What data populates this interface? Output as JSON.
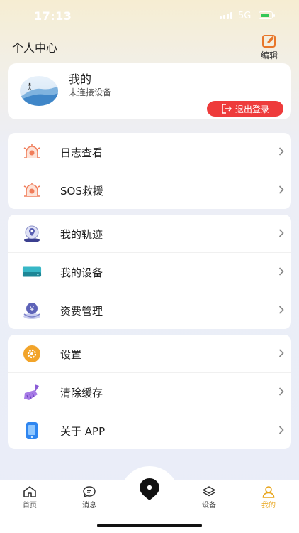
{
  "status_bar": {
    "time": "17:13",
    "network": "5G"
  },
  "header": {
    "title": "个人中心",
    "edit_label": "编辑"
  },
  "profile": {
    "name": "我的",
    "status": "未连接设备",
    "logout_label": "退出登录"
  },
  "menu_groups": [
    [
      {
        "label": "日志查看",
        "icon": "log-icon"
      },
      {
        "label": "SOS救援",
        "icon": "sos-icon"
      }
    ],
    [
      {
        "label": "我的轨迹",
        "icon": "track-icon"
      },
      {
        "label": "我的设备",
        "icon": "device-icon"
      },
      {
        "label": "资费管理",
        "icon": "billing-icon"
      }
    ],
    [
      {
        "label": "设置",
        "icon": "gear-icon"
      },
      {
        "label": "清除缓存",
        "icon": "broom-icon"
      },
      {
        "label": "关于 APP",
        "icon": "phone-icon"
      }
    ]
  ],
  "tabbar": {
    "items": [
      {
        "label": "首页",
        "icon": "home-icon"
      },
      {
        "label": "消息",
        "icon": "message-icon"
      },
      {
        "label": "设备",
        "icon": "layers-icon"
      },
      {
        "label": "我的",
        "icon": "user-icon"
      }
    ],
    "center_icon": "location-pin-icon",
    "active_color": "#e8a51b"
  },
  "colors": {
    "accent": "#e8a51b",
    "logout": "#ee3b3b",
    "edit_icon": "#e8762a"
  }
}
